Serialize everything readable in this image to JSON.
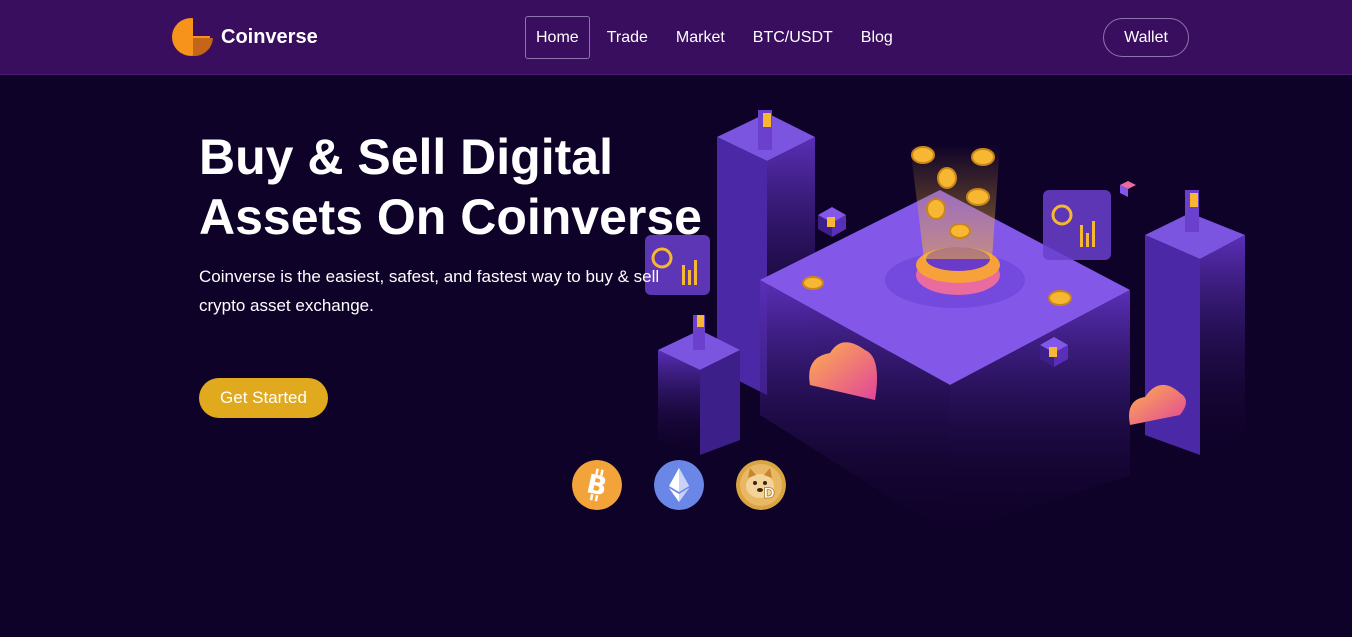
{
  "navbar": {
    "brand": "Coinverse",
    "menu": [
      {
        "label": "Home",
        "active": true
      },
      {
        "label": "Trade",
        "active": false
      },
      {
        "label": "Market",
        "active": false
      },
      {
        "label": "BTC/USDT",
        "active": false
      },
      {
        "label": "Blog",
        "active": false
      }
    ],
    "wallet_label": "Wallet"
  },
  "hero": {
    "title_line1": "Buy & Sell Digital",
    "title_line2": "Assets On Coinverse",
    "description": "Coinverse is the easiest, safest, and fastest way to buy & sell crypto asset exchange.",
    "cta_label": "Get Started"
  },
  "coins": [
    {
      "icon": "bitcoin-icon",
      "color": "#f2a43a"
    },
    {
      "icon": "ethereum-icon",
      "color": "#6a87e8"
    },
    {
      "icon": "dogecoin-icon",
      "color": "#d9a441"
    }
  ],
  "colors": {
    "navbar_bg": "#390e5e",
    "page_bg": "#0f0229",
    "accent": "#e0a91e",
    "illustration_purple": "#6f3fd1"
  }
}
